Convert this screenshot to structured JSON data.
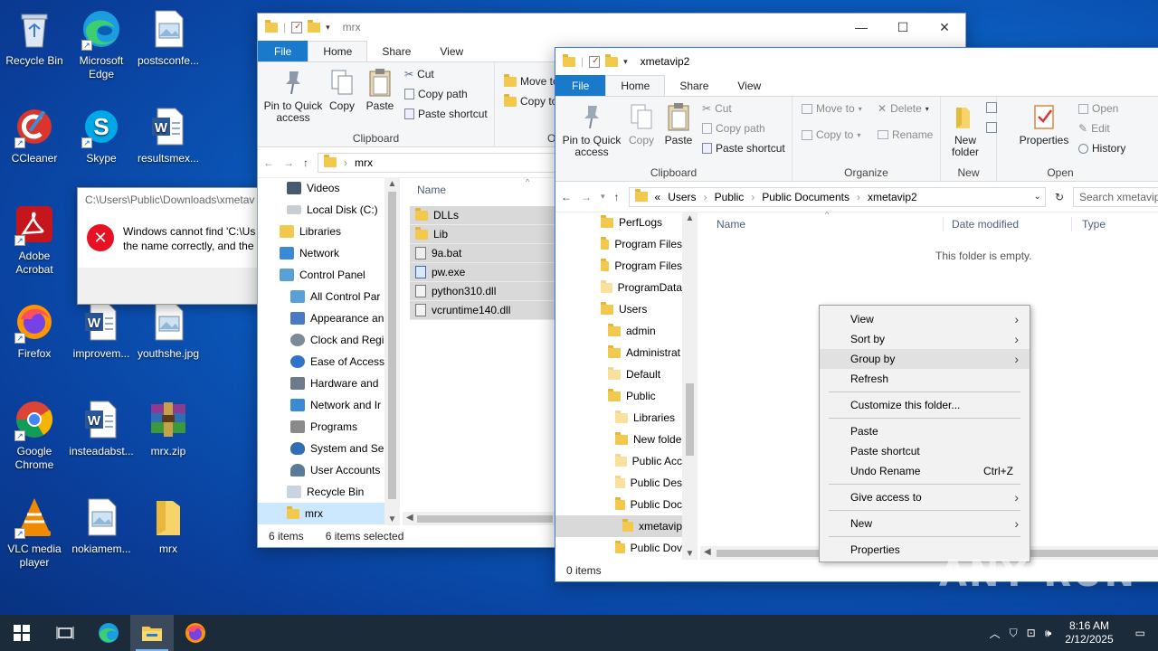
{
  "desktop": {
    "icons": [
      {
        "label": "Recycle Bin"
      },
      {
        "label": "Microsoft Edge"
      },
      {
        "label": "postsconfe..."
      },
      {
        "label": "CCleaner"
      },
      {
        "label": "Skype"
      },
      {
        "label": "resultsmex..."
      },
      {
        "label": "Adobe Acrobat"
      },
      {
        "label": "Firefox"
      },
      {
        "label": "improvem..."
      },
      {
        "label": "youthshe.jpg"
      },
      {
        "label": "Google Chrome"
      },
      {
        "label": "insteadabst..."
      },
      {
        "label": "mrx.zip"
      },
      {
        "label": "VLC media player"
      },
      {
        "label": "nokiamem..."
      },
      {
        "label": "mrx"
      }
    ]
  },
  "error_dialog": {
    "path": "C:\\Users\\Public\\Downloads\\xmetav",
    "message_line1": "Windows cannot find 'C:\\Us",
    "message_line2": "the name correctly, and the"
  },
  "win1": {
    "title": "mrx",
    "tabs": {
      "file": "File",
      "home": "Home",
      "share": "Share",
      "view": "View"
    },
    "ribbon": {
      "pin": "Pin to Quick access",
      "copy": "Copy",
      "paste": "Paste",
      "cut": "Cut",
      "copy_path": "Copy path",
      "paste_shortcut": "Paste shortcut",
      "clipboard": "Clipboard",
      "move_to": "Move to",
      "copy_to": "Copy to",
      "organize_short": "O"
    },
    "address": "mrx",
    "nav": [
      {
        "label": "Videos"
      },
      {
        "label": "Local Disk (C:)"
      },
      {
        "label": "Libraries"
      },
      {
        "label": "Network"
      },
      {
        "label": "Control Panel"
      },
      {
        "label": "All Control Par"
      },
      {
        "label": "Appearance an"
      },
      {
        "label": "Clock and Regi"
      },
      {
        "label": "Ease of Access"
      },
      {
        "label": "Hardware and"
      },
      {
        "label": "Network and Ir"
      },
      {
        "label": "Programs"
      },
      {
        "label": "System and Se"
      },
      {
        "label": "User Accounts"
      },
      {
        "label": "Recycle Bin"
      },
      {
        "label": "mrx"
      }
    ],
    "column_name": "Name",
    "files": [
      {
        "name": "DLLs"
      },
      {
        "name": "Lib"
      },
      {
        "name": "9a.bat"
      },
      {
        "name": "pw.exe"
      },
      {
        "name": "python310.dll"
      },
      {
        "name": "vcruntime140.dll"
      }
    ],
    "status_items": "6 items",
    "status_selected": "6 items selected"
  },
  "win2": {
    "title": "xmetavip2",
    "tabs": {
      "file": "File",
      "home": "Home",
      "share": "Share",
      "view": "View"
    },
    "ribbon": {
      "pin": "Pin to Quick access",
      "copy": "Copy",
      "paste": "Paste",
      "cut": "Cut",
      "copy_path": "Copy path",
      "paste_shortcut": "Paste shortcut",
      "clipboard": "Clipboard",
      "move_to": "Move to",
      "copy_to": "Copy to",
      "delete": "Delete",
      "rename": "Rename",
      "organize": "Organize",
      "new_folder": "New folder",
      "new": "New",
      "properties": "Properties",
      "open": "Open",
      "edit": "Edit",
      "history": "History",
      "open_group": "Open"
    },
    "breadcrumbs": [
      "«",
      "Users",
      "Public",
      "Public Documents",
      "xmetavip2"
    ],
    "search_placeholder": "Search xmetavip",
    "nav": [
      {
        "label": "PerfLogs"
      },
      {
        "label": "Program Files"
      },
      {
        "label": "Program Files"
      },
      {
        "label": "ProgramData"
      },
      {
        "label": "Users"
      },
      {
        "label": "admin"
      },
      {
        "label": "Administrat"
      },
      {
        "label": "Default"
      },
      {
        "label": "Public"
      },
      {
        "label": "Libraries"
      },
      {
        "label": "New folde"
      },
      {
        "label": "Public Acc"
      },
      {
        "label": "Public Des"
      },
      {
        "label": "Public Doc"
      },
      {
        "label": "xmetavip"
      },
      {
        "label": "Public Dov"
      }
    ],
    "columns": {
      "name": "Name",
      "date": "Date modified",
      "type": "Type"
    },
    "empty_text": "This folder is empty.",
    "status_items": "0 items"
  },
  "context_menu": {
    "view": "View",
    "sort_by": "Sort by",
    "group_by": "Group by",
    "refresh": "Refresh",
    "customize": "Customize this folder...",
    "paste": "Paste",
    "paste_shortcut": "Paste shortcut",
    "undo_rename": "Undo Rename",
    "undo_shortcut": "Ctrl+Z",
    "give_access": "Give access to",
    "new": "New",
    "properties": "Properties"
  },
  "taskbar": {
    "time": "8:16 AM",
    "date": "2/12/2025"
  },
  "watermark": "ANY RUN",
  "colors": {
    "accent": "#1979ca",
    "selection": "#cce8ff",
    "folder": "#f3c94d"
  }
}
